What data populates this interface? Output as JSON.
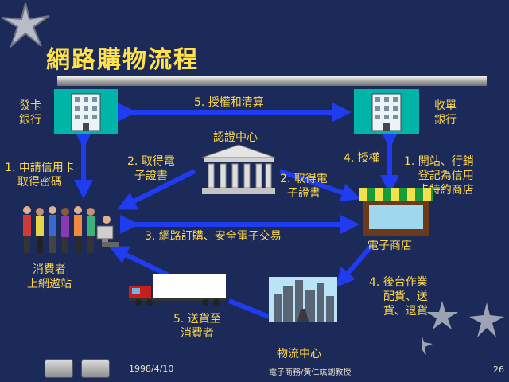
{
  "title": "網路購物流程",
  "nodes": {
    "issuing_bank": "發卡\n銀行",
    "acquiring_bank": "收單\n銀行",
    "certification_center": "認證中心",
    "consumer": "消費者\n上網遨站",
    "e_store": "電子商店",
    "logistics_center": "物流中心",
    "truck_icon": "truck-icon",
    "building_icon": "building-icon",
    "temple_icon": "temple-icon",
    "shop_icon": "shop-icon",
    "city_icon": "city-icon",
    "people_icon": "people-icon"
  },
  "steps": {
    "authorization_clearing": "5. 授權和清算",
    "apply_card": "1. 申請信用卡\n取得密碼",
    "consumer_cert": "2. 取得電\n子證書",
    "store_cert": "2. 取得電\n子證書",
    "authorization": "4. 授權",
    "open_store": "1. 開站、行銷\n登記為信用\n卡特約商店",
    "online_order": "3. 網路訂購、安全電子交易",
    "backend": "4. 後台作業\n配貨、送\n貨、退貨",
    "delivery": "5. 送貨至\n消費者"
  },
  "footer": {
    "date": "1998/4/10",
    "author": "電子商務/黃仁竑副教授",
    "page": "26"
  },
  "colors": {
    "background": "#1c2a5a",
    "arrow": "#1f3cf0",
    "title": "#ffe14a",
    "label": "#ffd84a"
  }
}
